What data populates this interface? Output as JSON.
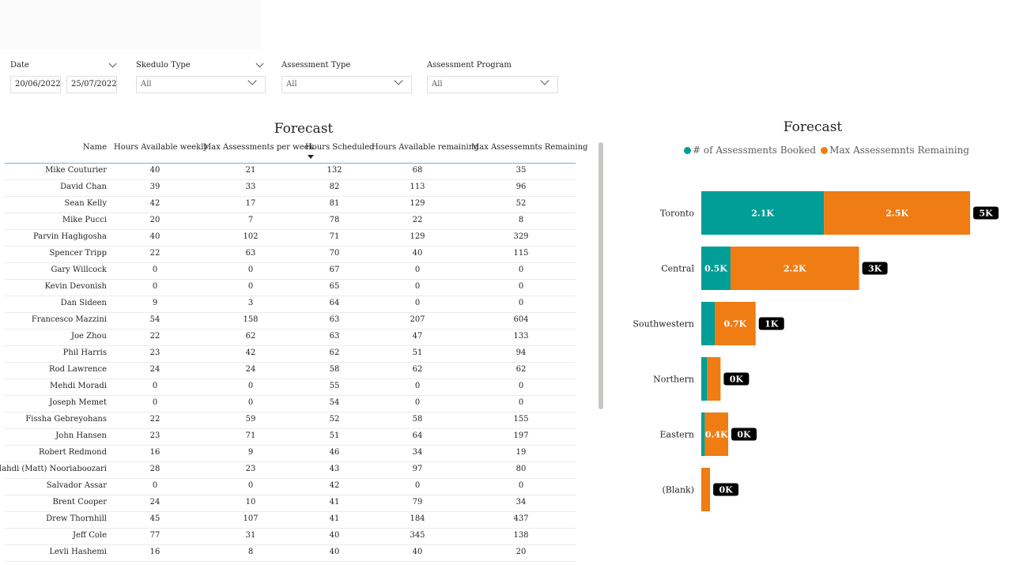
{
  "filters": {
    "date": {
      "label": "Date",
      "start": "20/06/2022",
      "end": "25/07/2022"
    },
    "skedulo_type": {
      "label": "Skedulo Type",
      "value": "All"
    },
    "assessment_type": {
      "label": "Assessment Type",
      "value": "All"
    },
    "assessment_program": {
      "label": "Assessment Program",
      "value": "All"
    }
  },
  "table": {
    "title": "Forecast",
    "headers": [
      "Name",
      "Hours Available weekly",
      "Max Assessments per week",
      "Hours Scheduled",
      "Hours Available remaining",
      "Max Assessemnts Remaining"
    ],
    "rows": [
      [
        "Mike Couturier",
        "40",
        "21",
        "132",
        "68",
        "35"
      ],
      [
        "David Chan",
        "39",
        "33",
        "82",
        "113",
        "96"
      ],
      [
        "Sean Kelly",
        "42",
        "17",
        "81",
        "129",
        "52"
      ],
      [
        "Mike Pucci",
        "20",
        "7",
        "78",
        "22",
        "8"
      ],
      [
        "Parvin Haghgosha",
        "40",
        "102",
        "71",
        "129",
        "329"
      ],
      [
        "Spencer Tripp",
        "22",
        "63",
        "70",
        "40",
        "115"
      ],
      [
        "Gary Willcock",
        "0",
        "0",
        "67",
        "0",
        "0"
      ],
      [
        "Kevin Devonish",
        "0",
        "0",
        "65",
        "0",
        "0"
      ],
      [
        "Dan Sideen",
        "9",
        "3",
        "64",
        "0",
        "0"
      ],
      [
        "Francesco Mazzini",
        "54",
        "158",
        "63",
        "207",
        "604"
      ],
      [
        "Joe Zhou",
        "22",
        "62",
        "63",
        "47",
        "133"
      ],
      [
        "Phil Harris",
        "23",
        "42",
        "62",
        "51",
        "94"
      ],
      [
        "Rod Lawrence",
        "24",
        "24",
        "58",
        "62",
        "62"
      ],
      [
        "Mehdi Moradi",
        "0",
        "0",
        "55",
        "0",
        "0"
      ],
      [
        "Joseph Memet",
        "0",
        "0",
        "54",
        "0",
        "0"
      ],
      [
        "Fissha Gebreyohans",
        "22",
        "59",
        "52",
        "58",
        "155"
      ],
      [
        "John Hansen",
        "23",
        "71",
        "51",
        "64",
        "197"
      ],
      [
        "Robert Redmond",
        "16",
        "9",
        "46",
        "34",
        "19"
      ],
      [
        "Mahdi (Matt) Nooriaboozari",
        "28",
        "23",
        "43",
        "97",
        "80"
      ],
      [
        "Salvador Assar",
        "0",
        "0",
        "42",
        "0",
        "0"
      ],
      [
        "Brent Cooper",
        "24",
        "10",
        "41",
        "79",
        "34"
      ],
      [
        "Drew Thornhill",
        "45",
        "107",
        "41",
        "184",
        "437"
      ],
      [
        "Jeff Cole",
        "77",
        "31",
        "40",
        "345",
        "138"
      ],
      [
        "Levli Hashemi",
        "16",
        "8",
        "40",
        "40",
        "20"
      ]
    ]
  },
  "chart_data": {
    "type": "bar",
    "orientation": "horizontal",
    "stacked": true,
    "title": "Forecast",
    "legend_position": "top",
    "categories": [
      "Toronto",
      "Central",
      "Southwestern",
      "Northern",
      "Eastern",
      "(Blank)"
    ],
    "series": [
      {
        "name": "# of Assessments Booked",
        "color": "#009e96",
        "values": [
          2100,
          500,
          230,
          100,
          60,
          0
        ],
        "labels": [
          "2.1K",
          "0.5K",
          "",
          "",
          "",
          ""
        ]
      },
      {
        "name": "Max Assessemnts Remaining",
        "color": "#f07c14",
        "values": [
          2500,
          2200,
          700,
          230,
          400,
          150
        ],
        "labels": [
          "2.5K",
          "2.2K",
          "0.7K",
          "",
          "0.4K",
          ""
        ]
      }
    ],
    "totals": [
      "5K",
      "3K",
      "1K",
      "0K",
      "0K",
      "0K"
    ],
    "xlim": [
      0,
      4600
    ],
    "grid": false
  }
}
